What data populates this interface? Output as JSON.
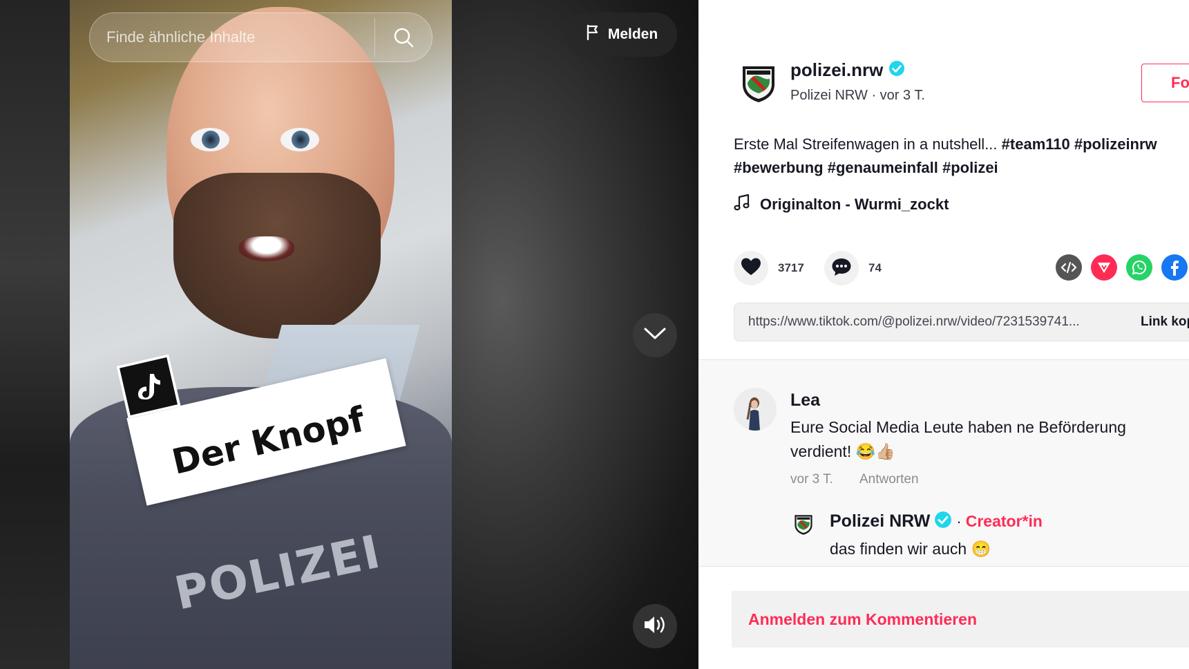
{
  "search": {
    "placeholder": "Finde ähnliche Inhalte",
    "icon": "search-icon"
  },
  "report": {
    "label": "Melden",
    "icon": "flag-icon"
  },
  "video": {
    "overlay_text": "Der Knopf",
    "vest_text": "POLIZEI",
    "controls": {
      "next_icon": "chevron-down-icon",
      "volume_icon": "volume-icon"
    }
  },
  "author": {
    "handle": "polizei.nrw",
    "verified": true,
    "display_name": "Polizei NRW",
    "separator": "·",
    "posted": "vor 3 T.",
    "follow_label": "Folgen"
  },
  "caption": {
    "text": "Erste Mal Streifenwagen in a nutshell...",
    "hashtags_line1": [
      "#team110",
      "#polizeinrw"
    ],
    "hashtags_line2": [
      "#bewerbung",
      "#genaumeinfall",
      "#polizei"
    ]
  },
  "music": {
    "icon": "music-note-icon",
    "title": "Originalton - Wurmi_zockt"
  },
  "stats": {
    "likes": "3717",
    "comments": "74"
  },
  "share": {
    "icons": [
      "embed-icon",
      "telegram-icon",
      "whatsapp-icon",
      "facebook-icon"
    ],
    "colors": {
      "embed": "#555555",
      "telegram": "#fe2c55",
      "whatsapp": "#25d366",
      "facebook": "#1877f2"
    }
  },
  "link": {
    "url": "https://www.tiktok.com/@polizei.nrw/video/7231539741...",
    "copy_label": "Link kopieren"
  },
  "comments": [
    {
      "author": "Lea",
      "text": "Eure Social Media Leute haben ne Beförderung verdient! 😂👍🏼",
      "time": "vor 3 T.",
      "reply_label": "Antworten",
      "replies": [
        {
          "author": "Polizei NRW",
          "verified": true,
          "separator": "·",
          "role": "Creator*in",
          "text": "das finden wir auch 😁"
        }
      ]
    }
  ],
  "login_comment": {
    "label": "Anmelden zum Kommentieren"
  },
  "colors": {
    "accent": "#fe2c55",
    "verified": "#20d5ec",
    "text": "#161823"
  }
}
